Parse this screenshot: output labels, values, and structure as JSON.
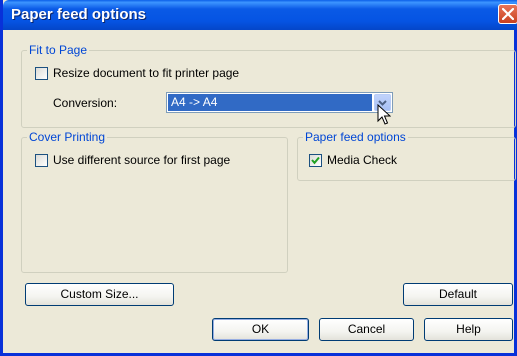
{
  "window": {
    "title": "Paper feed options"
  },
  "fit_to_page": {
    "legend": "Fit to Page",
    "resize_label": "Resize document to fit printer page",
    "resize_checked": false,
    "conversion_label": "Conversion:",
    "conversion_value": "A4 -> A4"
  },
  "cover_printing": {
    "legend": "Cover Printing",
    "different_source_label": "Use different source for first page",
    "different_source_checked": false
  },
  "paper_feed": {
    "legend": "Paper feed options",
    "media_check_label": "Media Check",
    "media_check_checked": true
  },
  "buttons": {
    "custom_size": "Custom Size...",
    "default": "Default",
    "ok": "OK",
    "cancel": "Cancel",
    "help": "Help"
  },
  "colors": {
    "titlebar": "#0554e3",
    "group_legend": "#0046d5",
    "selection": "#316ac5",
    "checkmark": "#21a121"
  },
  "icons": [
    "close-icon",
    "chevron-down-icon",
    "checkmark-icon",
    "mouse-cursor-icon"
  ]
}
